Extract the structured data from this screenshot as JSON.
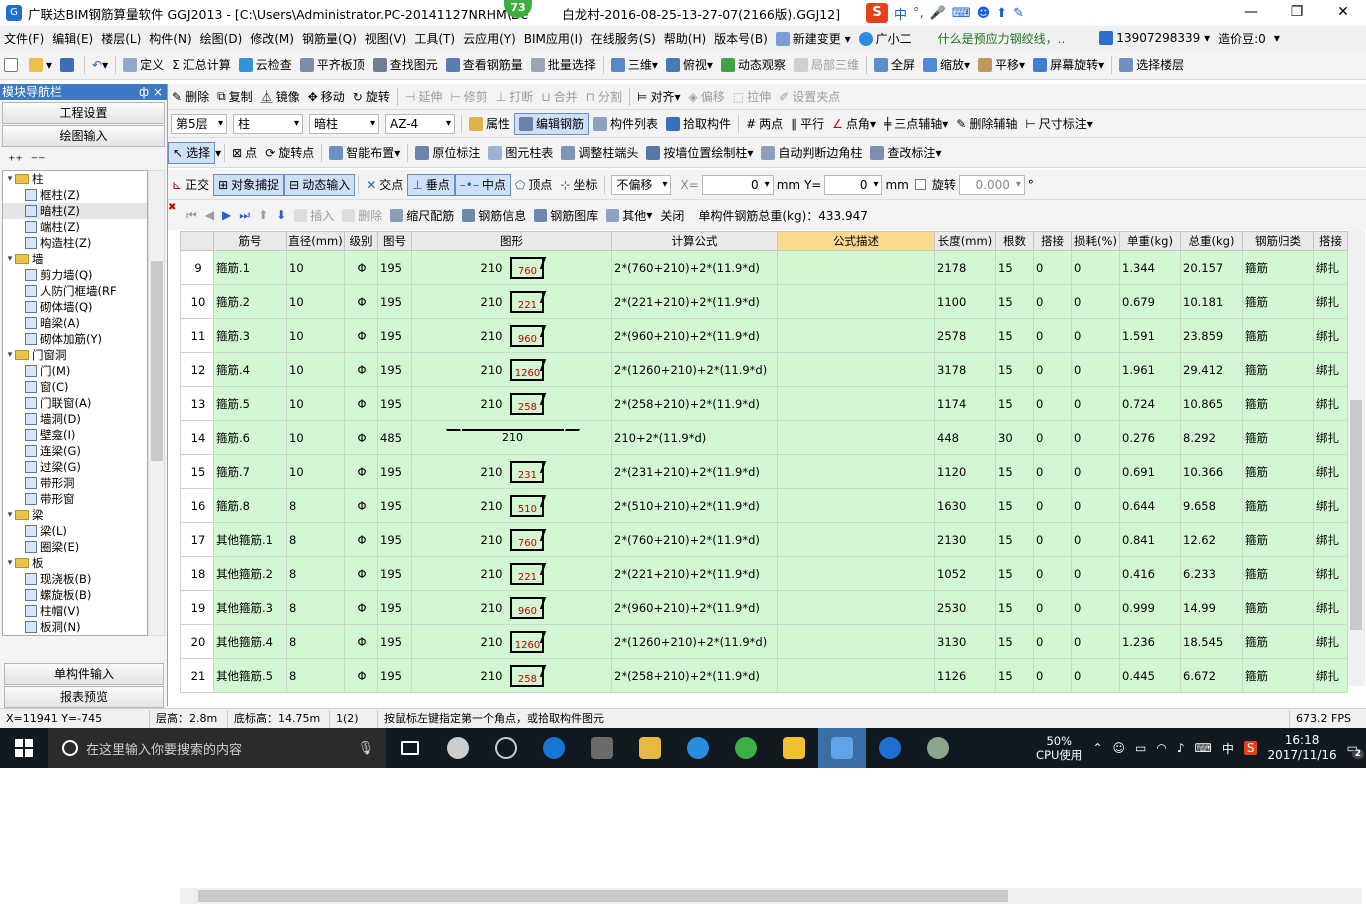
{
  "window": {
    "title": "广联达BIM钢筋算量软件 GGJ2013 - [C:\\Users\\Administrator.PC-20141127NRHM\\De",
    "title_rest": "白龙村-2016-08-25-13-27-07(2166版).GGJ12]",
    "badge": "73",
    "ime": [
      "中",
      "°,"
    ]
  },
  "menu": {
    "items": [
      "文件(F)",
      "编辑(E)",
      "楼层(L)",
      "构件(N)",
      "绘图(D)",
      "修改(M)",
      "钢筋量(Q)",
      "视图(V)",
      "工具(T)",
      "云应用(Y)",
      "BIM应用(I)",
      "在线服务(S)",
      "帮助(H)",
      "版本号(B)"
    ],
    "new_change": "新建变更",
    "assistant": "广小二",
    "promo": "什么是预应力钢绞线，..",
    "phone": "13907298339",
    "price_bean": "造价豆:0"
  },
  "toolbar1": {
    "items": [
      "定义",
      "汇总计算",
      "云检查",
      "平齐板顶",
      "查找图元",
      "查看钢筋量",
      "批量选择",
      "三维",
      "俯视",
      "动态观察",
      "局部三维",
      "全屏",
      "缩放",
      "平移",
      "屏幕旋转",
      "选择楼层"
    ]
  },
  "toolbar2": {
    "items": [
      "删除",
      "复制",
      "镜像",
      "移动",
      "旋转",
      "延伸",
      "修剪",
      "打断",
      "合并",
      "分割",
      "对齐",
      "偏移",
      "拉伸",
      "设置夹点"
    ]
  },
  "toolbar3": {
    "floor": "第5层",
    "type": "柱",
    "subtype": "暗柱",
    "name": "AZ-4",
    "items": [
      "属性",
      "编辑钢筋",
      "构件列表",
      "拾取构件",
      "两点",
      "平行",
      "点角",
      "三点辅轴",
      "删除辅轴",
      "尺寸标注"
    ]
  },
  "toolbar4": {
    "items": [
      "选择",
      "点",
      "旋转点",
      "智能布置",
      "原位标注",
      "图元柱表",
      "调整柱端头",
      "按墙位置绘制柱",
      "自动判断边角柱",
      "查改标注"
    ]
  },
  "toolbar5": {
    "items": [
      "正交",
      "对象捕捉",
      "动态输入",
      "交点",
      "垂点",
      "中点",
      "顶点",
      "坐标"
    ],
    "offset": "不偏移",
    "x_label": "X=",
    "x_value": "0",
    "y_label": "Y=",
    "y_value": "0",
    "unit": "mm",
    "rotate_label": "旋转",
    "rotate_value": "0.000",
    "degree": "°"
  },
  "leftpanel": {
    "title": "模块导航栏",
    "pin": "ф ×",
    "btn_settings": "工程设置",
    "btn_draw": "绘图输入",
    "btn_single": "单构件输入",
    "btn_report": "报表预览",
    "tree": [
      {
        "t": "柱",
        "lvl": 0,
        "folder": true
      },
      {
        "t": "框柱(Z)",
        "lvl": 1
      },
      {
        "t": "暗柱(Z)",
        "lvl": 1,
        "sel": true
      },
      {
        "t": "端柱(Z)",
        "lvl": 1
      },
      {
        "t": "构造柱(Z)",
        "lvl": 1
      },
      {
        "t": "墙",
        "lvl": 0,
        "folder": true
      },
      {
        "t": "剪力墙(Q)",
        "lvl": 1
      },
      {
        "t": "人防门框墙(RF",
        "lvl": 1
      },
      {
        "t": "砌体墙(Q)",
        "lvl": 1
      },
      {
        "t": "暗梁(A)",
        "lvl": 1
      },
      {
        "t": "砌体加筋(Y)",
        "lvl": 1
      },
      {
        "t": "门窗洞",
        "lvl": 0,
        "folder": true
      },
      {
        "t": "门(M)",
        "lvl": 1
      },
      {
        "t": "窗(C)",
        "lvl": 1
      },
      {
        "t": "门联窗(A)",
        "lvl": 1
      },
      {
        "t": "墙洞(D)",
        "lvl": 1
      },
      {
        "t": "壁龛(I)",
        "lvl": 1
      },
      {
        "t": "连梁(G)",
        "lvl": 1
      },
      {
        "t": "过梁(G)",
        "lvl": 1
      },
      {
        "t": "带形洞",
        "lvl": 1
      },
      {
        "t": "带形窗",
        "lvl": 1
      },
      {
        "t": "梁",
        "lvl": 0,
        "folder": true
      },
      {
        "t": "梁(L)",
        "lvl": 1
      },
      {
        "t": "圈梁(E)",
        "lvl": 1
      },
      {
        "t": "板",
        "lvl": 0,
        "folder": true
      },
      {
        "t": "现浇板(B)",
        "lvl": 1
      },
      {
        "t": "螺旋板(B)",
        "lvl": 1
      },
      {
        "t": "柱帽(V)",
        "lvl": 1
      },
      {
        "t": "板洞(N)",
        "lvl": 1
      }
    ]
  },
  "gridtoolbar": {
    "items": [
      "插入",
      "删除",
      "缩尺配筋",
      "钢筋信息",
      "钢筋图库",
      "其他",
      "关闭"
    ],
    "total": "单构件钢筋总重(kg)：433.947"
  },
  "grid": {
    "headers": [
      "筋号",
      "直径(mm)",
      "级别",
      "图号",
      "图形",
      "计算公式",
      "公式描述",
      "长度(mm)",
      "根数",
      "搭接",
      "损耗(%)",
      "单重(kg)",
      "总重(kg)",
      "钢筋归类",
      "搭接"
    ],
    "rows": [
      {
        "n": "9",
        "name": "箍筋.1",
        "d": "10",
        "g": "Φ",
        "fig_no": "195",
        "w": "210",
        "h": "760",
        "formula": "2*(760+210)+2*(11.9*d)",
        "len": "2178",
        "cnt": "15",
        "lap": "0",
        "loss": "0",
        "unit": "1.344",
        "total": "20.157",
        "cls": "箍筋",
        "lapt": "绑扎"
      },
      {
        "n": "10",
        "name": "箍筋.2",
        "d": "10",
        "g": "Φ",
        "fig_no": "195",
        "w": "210",
        "h": "221",
        "formula": "2*(221+210)+2*(11.9*d)",
        "len": "1100",
        "cnt": "15",
        "lap": "0",
        "loss": "0",
        "unit": "0.679",
        "total": "10.181",
        "cls": "箍筋",
        "lapt": "绑扎"
      },
      {
        "n": "11",
        "name": "箍筋.3",
        "d": "10",
        "g": "Φ",
        "fig_no": "195",
        "w": "210",
        "h": "960",
        "formula": "2*(960+210)+2*(11.9*d)",
        "len": "2578",
        "cnt": "15",
        "lap": "0",
        "loss": "0",
        "unit": "1.591",
        "total": "23.859",
        "cls": "箍筋",
        "lapt": "绑扎"
      },
      {
        "n": "12",
        "name": "箍筋.4",
        "d": "10",
        "g": "Φ",
        "fig_no": "195",
        "w": "210",
        "h": "1260",
        "formula": "2*(1260+210)+2*(11.9*d)",
        "len": "3178",
        "cnt": "15",
        "lap": "0",
        "loss": "0",
        "unit": "1.961",
        "total": "29.412",
        "cls": "箍筋",
        "lapt": "绑扎"
      },
      {
        "n": "13",
        "name": "箍筋.5",
        "d": "10",
        "g": "Φ",
        "fig_no": "195",
        "w": "210",
        "h": "258",
        "formula": "2*(258+210)+2*(11.9*d)",
        "len": "1174",
        "cnt": "15",
        "lap": "0",
        "loss": "0",
        "unit": "0.724",
        "total": "10.865",
        "cls": "箍筋",
        "lapt": "绑扎"
      },
      {
        "n": "14",
        "name": "箍筋.6",
        "d": "10",
        "g": "Φ",
        "fig_no": "485",
        "w": "210",
        "h": "",
        "hook": true,
        "formula": "210+2*(11.9*d)",
        "len": "448",
        "cnt": "30",
        "lap": "0",
        "loss": "0",
        "unit": "0.276",
        "total": "8.292",
        "cls": "箍筋",
        "lapt": "绑扎"
      },
      {
        "n": "15",
        "name": "箍筋.7",
        "d": "10",
        "g": "Φ",
        "fig_no": "195",
        "w": "210",
        "h": "231",
        "formula": "2*(231+210)+2*(11.9*d)",
        "len": "1120",
        "cnt": "15",
        "lap": "0",
        "loss": "0",
        "unit": "0.691",
        "total": "10.366",
        "cls": "箍筋",
        "lapt": "绑扎"
      },
      {
        "n": "16",
        "name": "箍筋.8",
        "d": "8",
        "g": "Φ",
        "fig_no": "195",
        "w": "210",
        "h": "510",
        "formula": "2*(510+210)+2*(11.9*d)",
        "len": "1630",
        "cnt": "15",
        "lap": "0",
        "loss": "0",
        "unit": "0.644",
        "total": "9.658",
        "cls": "箍筋",
        "lapt": "绑扎"
      },
      {
        "n": "17",
        "name": "其他箍筋.1",
        "d": "8",
        "g": "Φ",
        "fig_no": "195",
        "w": "210",
        "h": "760",
        "formula": "2*(760+210)+2*(11.9*d)",
        "len": "2130",
        "cnt": "15",
        "lap": "0",
        "loss": "0",
        "unit": "0.841",
        "total": "12.62",
        "cls": "箍筋",
        "lapt": "绑扎"
      },
      {
        "n": "18",
        "name": "其他箍筋.2",
        "d": "8",
        "g": "Φ",
        "fig_no": "195",
        "w": "210",
        "h": "221",
        "formula": "2*(221+210)+2*(11.9*d)",
        "len": "1052",
        "cnt": "15",
        "lap": "0",
        "loss": "0",
        "unit": "0.416",
        "total": "6.233",
        "cls": "箍筋",
        "lapt": "绑扎"
      },
      {
        "n": "19",
        "name": "其他箍筋.3",
        "d": "8",
        "g": "Φ",
        "fig_no": "195",
        "w": "210",
        "h": "960",
        "formula": "2*(960+210)+2*(11.9*d)",
        "len": "2530",
        "cnt": "15",
        "lap": "0",
        "loss": "0",
        "unit": "0.999",
        "total": "14.99",
        "cls": "箍筋",
        "lapt": "绑扎"
      },
      {
        "n": "20",
        "name": "其他箍筋.4",
        "d": "8",
        "g": "Φ",
        "fig_no": "195",
        "w": "210",
        "h": "1260",
        "formula": "2*(1260+210)+2*(11.9*d)",
        "len": "3130",
        "cnt": "15",
        "lap": "0",
        "loss": "0",
        "unit": "1.236",
        "total": "18.545",
        "cls": "箍筋",
        "lapt": "绑扎"
      },
      {
        "n": "21",
        "name": "其他箍筋.5",
        "d": "8",
        "g": "Φ",
        "fig_no": "195",
        "w": "210",
        "h": "258",
        "formula": "2*(258+210)+2*(11.9*d)",
        "len": "1126",
        "cnt": "15",
        "lap": "0",
        "loss": "0",
        "unit": "0.445",
        "total": "6.672",
        "cls": "箍筋",
        "lapt": "绑扎"
      }
    ]
  },
  "status": {
    "coords": "X=11941 Y=-745",
    "floor_h": "层高：2.8m",
    "bottom_h": "底标高：14.75m",
    "count": "1(2)",
    "hint": "按鼠标左键指定第一个角点，或拾取构件图元",
    "fps": "673.2 FPS"
  },
  "taskbar": {
    "search_placeholder": "在这里输入你要搜索的内容",
    "cpu_pct": "50%",
    "cpu_label": "CPU使用",
    "lang": "中",
    "time": "16:18",
    "date": "2017/11/16",
    "notif": "2"
  },
  "colors": {
    "accent": "#3c78c4",
    "grid_green": "#d3f7d3",
    "hl_header": "#fbd98f"
  }
}
